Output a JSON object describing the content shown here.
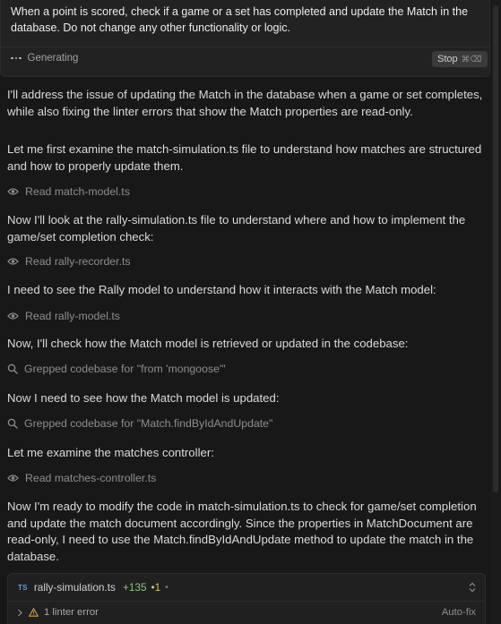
{
  "prompt": {
    "text": "When a point is scored, check if a game or a set has completed and update the Match in the database. Do not change any other functionality or logic.",
    "status_label": "Generating",
    "stop_label": "Stop",
    "stop_shortcut": "⌘⌫"
  },
  "conversation": [
    {
      "kind": "text",
      "text": "I'll address the issue of updating the Match in the database when a game or set completes, while also fixing the linter errors that show the Match properties are read-only."
    },
    {
      "kind": "text",
      "text": "Let me first examine the match-simulation.ts file to understand how matches are structured and how to properly update them."
    },
    {
      "kind": "tool",
      "icon": "eye-icon",
      "text": "Read match-model.ts"
    },
    {
      "kind": "text",
      "text": "Now I'll look at the rally-simulation.ts file to understand where and how to implement the game/set completion check:"
    },
    {
      "kind": "tool",
      "icon": "eye-icon",
      "text": "Read rally-recorder.ts"
    },
    {
      "kind": "text",
      "text": "I need to see the Rally model to understand how it interacts with the Match model:"
    },
    {
      "kind": "tool",
      "icon": "eye-icon",
      "text": "Read rally-model.ts"
    },
    {
      "kind": "text",
      "text": "Now, I'll check how the Match model is retrieved or updated in the codebase:"
    },
    {
      "kind": "tool",
      "icon": "search-icon",
      "text": "Grepped codebase for \"from 'mongoose'\""
    },
    {
      "kind": "text",
      "text": "Now I need to see how the Match model is updated:"
    },
    {
      "kind": "tool",
      "icon": "search-icon",
      "text": "Grepped codebase for \"Match.findByIdAndUpdate\""
    },
    {
      "kind": "text",
      "text": "Let me examine the matches controller:"
    },
    {
      "kind": "tool",
      "icon": "eye-icon",
      "text": "Read matches-controller.ts"
    },
    {
      "kind": "text",
      "text": "Now I'm ready to modify the code in match-simulation.ts to check for game/set completion and update the match document accordingly. Since the properties in MatchDocument are read-only, I need to use the Match.findByIdAndUpdate method to update the match in the database."
    }
  ],
  "code_edit": {
    "lang_badge": "TS",
    "filename": "rally-simulation.ts",
    "additions": "+135",
    "modifications": "•1",
    "status_dot": "•",
    "lint_label": "1 linter error",
    "autofix_label": "Auto-fix"
  },
  "colors": {
    "background": "#181818",
    "text": "#dadada",
    "muted": "#8e8e8e",
    "added": "#8bc37a",
    "modified": "#cfc069",
    "ts_badge": "#5b9ee8"
  }
}
